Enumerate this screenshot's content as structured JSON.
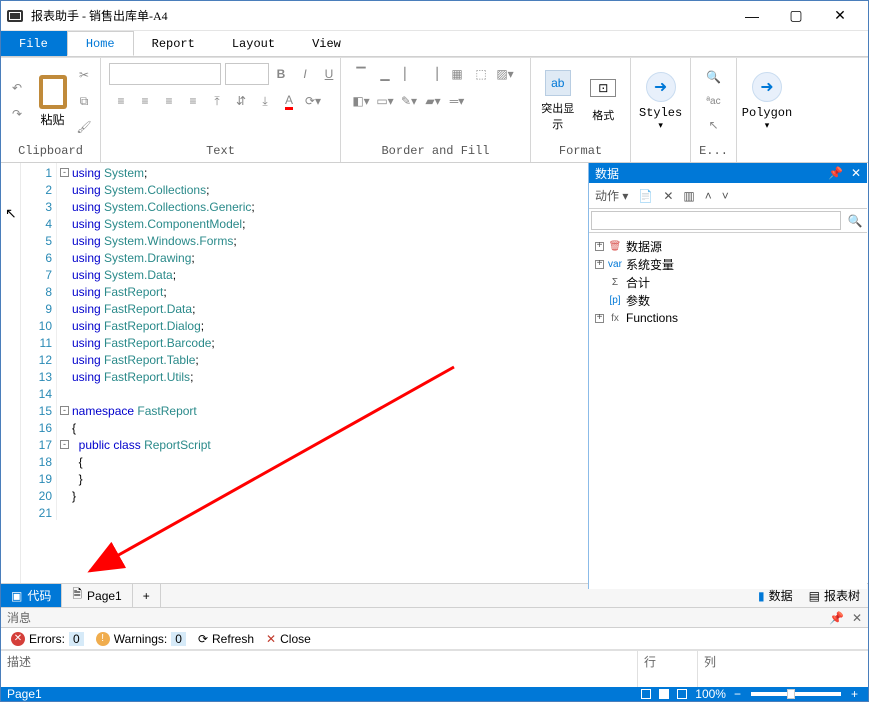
{
  "window": {
    "title": "报表助手 - 销售出库单-A4"
  },
  "tabs": {
    "file": "File",
    "home": "Home",
    "report": "Report",
    "layout": "Layout",
    "view": "View"
  },
  "ribbon": {
    "clipboard": {
      "label": "Clipboard",
      "paste": "粘贴"
    },
    "text": {
      "label": "Text"
    },
    "border": {
      "label": "Border and Fill"
    },
    "format": {
      "label": "Format",
      "highlight": "突出显示",
      "format": "格式"
    },
    "styles": {
      "label": "Styles"
    },
    "e": {
      "label": "E..."
    },
    "polygon": {
      "label": "Polygon"
    }
  },
  "code": {
    "lines": [
      {
        "n": 1,
        "fold": "[-]",
        "tokens": [
          [
            "kw",
            "using"
          ],
          [
            "tx",
            " "
          ],
          [
            "pl",
            "System"
          ],
          [
            "pn",
            ";"
          ]
        ]
      },
      {
        "n": 2,
        "tokens": [
          [
            "kw",
            "using"
          ],
          [
            "tx",
            " "
          ],
          [
            "pl",
            "System.Collections"
          ],
          [
            "pn",
            ";"
          ]
        ]
      },
      {
        "n": 3,
        "tokens": [
          [
            "kw",
            "using"
          ],
          [
            "tx",
            " "
          ],
          [
            "pl",
            "System.Collections.Generic"
          ],
          [
            "pn",
            ";"
          ]
        ]
      },
      {
        "n": 4,
        "tokens": [
          [
            "kw",
            "using"
          ],
          [
            "tx",
            " "
          ],
          [
            "pl",
            "System.ComponentModel"
          ],
          [
            "pn",
            ";"
          ]
        ]
      },
      {
        "n": 5,
        "tokens": [
          [
            "kw",
            "using"
          ],
          [
            "tx",
            " "
          ],
          [
            "pl",
            "System.Windows.Forms"
          ],
          [
            "pn",
            ";"
          ]
        ]
      },
      {
        "n": 6,
        "tokens": [
          [
            "kw",
            "using"
          ],
          [
            "tx",
            " "
          ],
          [
            "pl",
            "System.Drawing"
          ],
          [
            "pn",
            ";"
          ]
        ]
      },
      {
        "n": 7,
        "tokens": [
          [
            "kw",
            "using"
          ],
          [
            "tx",
            " "
          ],
          [
            "pl",
            "System.Data"
          ],
          [
            "pn",
            ";"
          ]
        ]
      },
      {
        "n": 8,
        "tokens": [
          [
            "kw",
            "using"
          ],
          [
            "tx",
            " "
          ],
          [
            "pl",
            "FastReport"
          ],
          [
            "pn",
            ";"
          ]
        ]
      },
      {
        "n": 9,
        "tokens": [
          [
            "kw",
            "using"
          ],
          [
            "tx",
            " "
          ],
          [
            "pl",
            "FastReport.Data"
          ],
          [
            "pn",
            ";"
          ]
        ]
      },
      {
        "n": 10,
        "tokens": [
          [
            "kw",
            "using"
          ],
          [
            "tx",
            " "
          ],
          [
            "pl",
            "FastReport.Dialog"
          ],
          [
            "pn",
            ";"
          ]
        ]
      },
      {
        "n": 11,
        "tokens": [
          [
            "kw",
            "using"
          ],
          [
            "tx",
            " "
          ],
          [
            "pl",
            "FastReport.Barcode"
          ],
          [
            "pn",
            ";"
          ]
        ]
      },
      {
        "n": 12,
        "tokens": [
          [
            "kw",
            "using"
          ],
          [
            "tx",
            " "
          ],
          [
            "pl",
            "FastReport.Table"
          ],
          [
            "pn",
            ";"
          ]
        ]
      },
      {
        "n": 13,
        "tokens": [
          [
            "kw",
            "using"
          ],
          [
            "tx",
            " "
          ],
          [
            "pl",
            "FastReport.Utils"
          ],
          [
            "pn",
            ";"
          ]
        ]
      },
      {
        "n": 14,
        "tokens": []
      },
      {
        "n": 15,
        "fold": "[-]",
        "tokens": [
          [
            "kw",
            "namespace"
          ],
          [
            "tx",
            " "
          ],
          [
            "pl",
            "FastReport"
          ]
        ]
      },
      {
        "n": 16,
        "tokens": [
          [
            "pn",
            "{"
          ]
        ]
      },
      {
        "n": 17,
        "fold": "[-]",
        "tokens": [
          [
            "tx",
            "  "
          ],
          [
            "kw",
            "public"
          ],
          [
            "tx",
            " "
          ],
          [
            "kw",
            "class"
          ],
          [
            "tx",
            " "
          ],
          [
            "pl",
            "ReportScript"
          ]
        ]
      },
      {
        "n": 18,
        "tokens": [
          [
            "tx",
            "  "
          ],
          [
            "pn",
            "{"
          ]
        ]
      },
      {
        "n": 19,
        "tokens": [
          [
            "tx",
            "  "
          ],
          [
            "pn",
            "}"
          ]
        ]
      },
      {
        "n": 20,
        "tokens": [
          [
            "pn",
            "}"
          ]
        ]
      },
      {
        "n": 21,
        "tokens": []
      }
    ]
  },
  "datapanel": {
    "title": "数据",
    "actions_label": "动作 ▾",
    "search_placeholder": "",
    "tree": [
      {
        "exp": "+",
        "icon": "🗑",
        "iconColor": "#d9534f",
        "label": "数据源"
      },
      {
        "exp": "+",
        "icon": "var",
        "iconColor": "#0078d7",
        "label": "系统变量"
      },
      {
        "exp": "",
        "icon": "Σ",
        "iconColor": "#555",
        "label": "合计"
      },
      {
        "exp": "",
        "icon": "[p]",
        "iconColor": "#0078d7",
        "label": "参数"
      },
      {
        "exp": "+",
        "icon": "fx",
        "iconColor": "#666",
        "label": "Functions"
      }
    ]
  },
  "pagetabs": {
    "code": "代码",
    "page1": "Page1",
    "add": "+",
    "data": "数据",
    "tree": "报表树"
  },
  "messages": {
    "title": "消息",
    "errors_label": "Errors:",
    "errors_count": "0",
    "warnings_label": "Warnings:",
    "warnings_count": "0",
    "refresh": "Refresh",
    "close": "Close",
    "col_desc": "描述",
    "col_line": "行",
    "col_col": "列"
  },
  "status": {
    "page": "Page1",
    "zoom": "100%"
  }
}
